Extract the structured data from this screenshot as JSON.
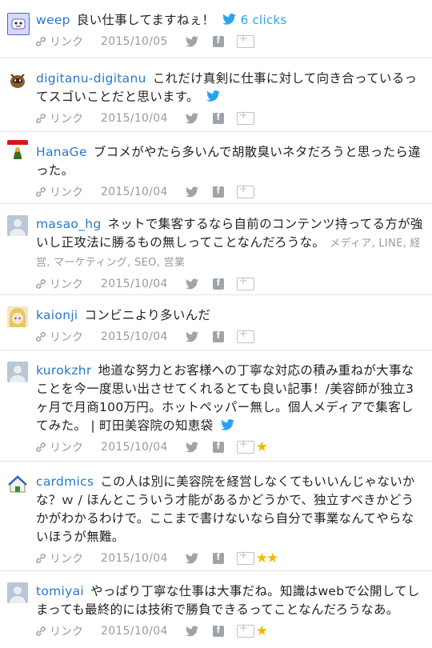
{
  "link_label": "リンク",
  "entries": [
    {
      "user": "weep",
      "comment": "良い仕事してますねぇ！",
      "clicks": "6 clicks",
      "tags": "",
      "date": "2015/10/05",
      "stars": ""
    },
    {
      "user": "digitanu-digitanu",
      "comment": "これだけ真剣に仕事に対して向き合っているってスゴいことだと思います。",
      "tags": "",
      "date": "2015/10/04",
      "stars": ""
    },
    {
      "user": "HanaGe",
      "comment": "ブコメがやたら多いんで胡散臭いネタだろうと思ったら違った。",
      "tags": "",
      "date": "2015/10/04",
      "stars": ""
    },
    {
      "user": "masao_hg",
      "comment": "ネットで集客するなら自前のコンテンツ持ってる方が強いし正攻法に勝るもの無しってことなんだろうな。",
      "tags": "メディア, LINE, 経営, マーケティング, SEO, 営業",
      "date": "2015/10/04",
      "stars": ""
    },
    {
      "user": "kaionji",
      "comment": "コンビニより多いんだ",
      "tags": "",
      "date": "2015/10/04",
      "stars": ""
    },
    {
      "user": "kurokzhr",
      "comment": "地道な努力とお客様への丁寧な対応の積み重ねが大事なことを今一度思い出させてくれるとても良い記事！/美容師が独立3ヶ月で月商100万円。ホットペッパー無し。個人メディアで集客してみた。 | 町田美容院の知恵袋",
      "tags": "",
      "date": "2015/10/04",
      "stars": "★"
    },
    {
      "user": "cardmics",
      "comment": "この人は別に美容院を経営しなくてもいいんじゃないかな？ｗ / ほんとこういう才能があるかどうかで、独立すべきかどうかがわかるわけで。ここまで書けないなら自分で事業なんてやらないほうが無難。",
      "tags": "",
      "date": "2015/10/04",
      "stars": "★★"
    },
    {
      "user": "tomiyai",
      "comment": "やっぱり丁寧な仕事は大事だね。知識はwebで公開してしまっても最終的には技術で勝負できるってことなんだろうなあ。",
      "tags": "",
      "date": "2015/10/04",
      "stars": "★"
    }
  ],
  "colors": {
    "username": "#2a78c8",
    "meta_gray": "#9a9a9a",
    "twitter_blue": "#2aa3ef",
    "star_gold": "#f2b705"
  }
}
